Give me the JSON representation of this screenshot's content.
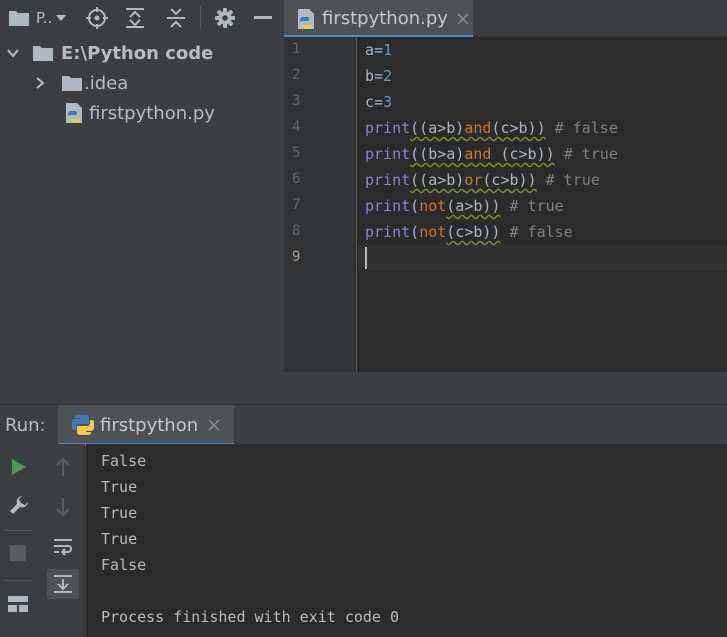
{
  "project_panel": {
    "title": "P..",
    "tree": {
      "root_label": "E:\\Python code",
      "idea_label": ".idea",
      "file_label": "firstpython.py"
    }
  },
  "editor": {
    "tab_label": "firstpython.py",
    "line_numbers": [
      "1",
      "2",
      "3",
      "4",
      "5",
      "6",
      "7",
      "8",
      "9"
    ],
    "current_line": "9",
    "code": {
      "l1": {
        "var": "a",
        "op": "=",
        "num": "1"
      },
      "l2": {
        "var": "b",
        "op": "=",
        "num": "2"
      },
      "l3": {
        "var": "c",
        "op": "=",
        "num": "3"
      },
      "l4": {
        "fn": "print",
        "p1": "((a>b)",
        "kw": "and",
        "p2": "(c>b))",
        "comment": " # false"
      },
      "l5": {
        "fn": "print",
        "p1": "((b>a)",
        "kw": "and",
        "p2": " (c>b))",
        "comment": " # true"
      },
      "l6": {
        "fn": "print",
        "p1": "((a>b)",
        "kw": "or",
        "p2": "(c>b))",
        "comment": " # true"
      },
      "l7": {
        "fn": "print",
        "p1": "(",
        "kw": "not",
        "p2": "(a>b))",
        "comment": " # true"
      },
      "l8": {
        "fn": "print",
        "p1": "(",
        "kw": "not",
        "p2": "(c>b))",
        "comment": " # false"
      }
    }
  },
  "run": {
    "label": "Run:",
    "tab_label": "firstpython",
    "output": [
      "False",
      "True",
      "True",
      "True",
      "False",
      "",
      "Process finished with exit code 0"
    ]
  },
  "colors": {
    "accent": "#4a88c7",
    "run_green": "#499c54",
    "keyword": "#cc7832",
    "builtin": "#8888c6",
    "number": "#6897bb",
    "comment": "#808080"
  },
  "icons": {
    "project": "folder-icon",
    "locate": "crosshair-icon",
    "expand_all": "expand-all-icon",
    "collapse_all": "collapse-all-icon",
    "settings": "gear-icon",
    "hide": "minimize-icon",
    "python_file": "python-file-icon",
    "run": "play-icon",
    "wrench": "wrench-icon",
    "stop": "stop-icon",
    "layout": "layout-icon",
    "up": "arrow-up-icon",
    "down": "arrow-down-icon",
    "soft_wrap": "soft-wrap-icon",
    "scroll_end": "scroll-to-end-icon"
  }
}
